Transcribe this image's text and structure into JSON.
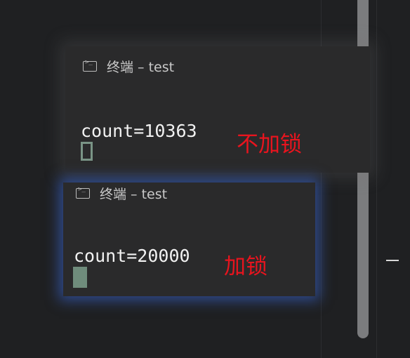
{
  "window_a": {
    "title": "终端 – test",
    "output": "count=10363",
    "annotation": "不加锁"
  },
  "window_b": {
    "title": "终端 – test",
    "output": "count=20000",
    "annotation": "加锁"
  },
  "icons": {
    "terminal": "terminal-icon"
  },
  "colors": {
    "annotation": "#e8141e",
    "focus_glow": "#3c6ee6",
    "cursor": "#6f8c7c"
  }
}
